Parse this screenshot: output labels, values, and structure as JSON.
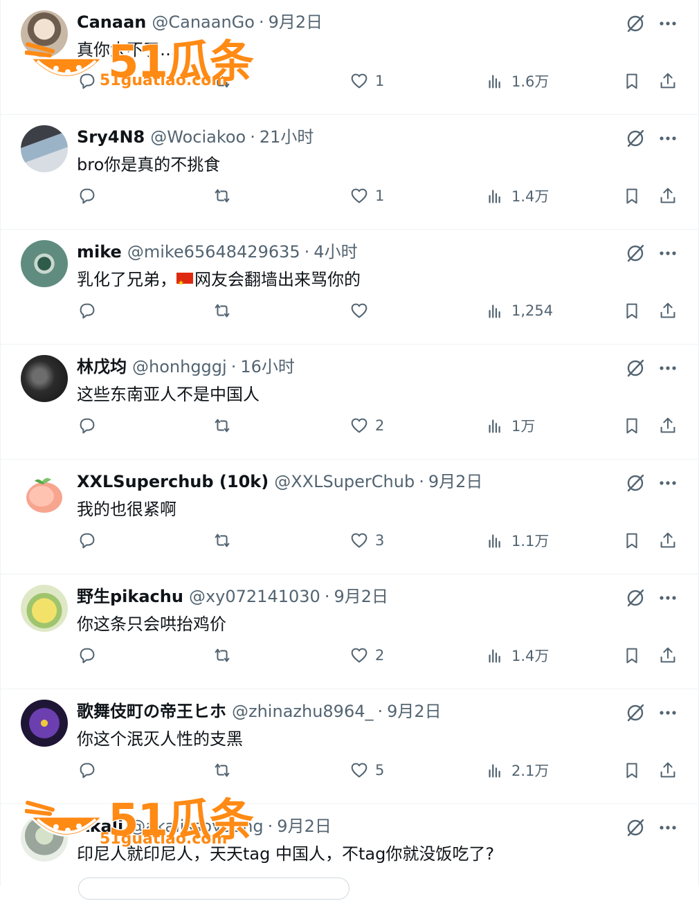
{
  "replies": [
    {
      "name": "Canaan",
      "handle": "@CanaanGo",
      "time": "9月2日",
      "text": "真你大不了…",
      "avatar_color": "#c8b8a6",
      "counts": {
        "reply": "",
        "retweet": "",
        "like": "1",
        "views": "1.6万"
      }
    },
    {
      "name": "Sry4N8",
      "handle": "@Wociakoo",
      "time": "21小时",
      "text": "bro你是真的不挑食",
      "avatar_color": "#5b6a7c",
      "counts": {
        "reply": "",
        "retweet": "",
        "like": "1",
        "views": "1.4万"
      }
    },
    {
      "name": "mike",
      "handle": "@mike65648429635",
      "time": "4小时",
      "text_before_flag": "乳化了兄弟，",
      "text": "网友会翻墙出来骂你的",
      "avatar_color": "#5f8c7e",
      "counts": {
        "reply": "",
        "retweet": "",
        "like": "",
        "views": "1,254"
      }
    },
    {
      "name": "林戊均",
      "handle": "@honhgggj",
      "time": "16小时",
      "text": "这些东南亚人不是中国人",
      "avatar_color": "#2c2c2c",
      "counts": {
        "reply": "",
        "retweet": "",
        "like": "2",
        "views": "1万"
      }
    },
    {
      "name": "XXLSuperchub (10k)",
      "handle": "@XXLSuperChub",
      "time": "9月2日",
      "text": "我的也很紧啊",
      "avatar_color": "#ffd9c9",
      "counts": {
        "reply": "",
        "retweet": "",
        "like": "3",
        "views": "1.1万"
      }
    },
    {
      "name": "野生pikachu",
      "handle": "@xy072141030",
      "time": "9月2日",
      "text": "你这条只会哄抬鸡价",
      "avatar_color": "#e8d55a",
      "counts": {
        "reply": "",
        "retweet": "",
        "like": "2",
        "views": "1.4万"
      }
    },
    {
      "name": "歌舞伎町の帝王ヒホ",
      "handle": "@zhinazhu8964_",
      "time": "9月2日",
      "text": "你这个泯灭人性的支黑",
      "avatar_color": "#3a2464",
      "counts": {
        "reply": "",
        "retweet": "",
        "like": "5",
        "views": "2.1万"
      }
    },
    {
      "name": "Akali",
      "handle": "@akaiissoyoung",
      "time": "9月2日",
      "text": "印尼人就印尼人，天天tag 中国人，不tag你就没饭吃了?",
      "avatar_color": "#9aa69c",
      "counts": {
        "reply": "",
        "retweet": "",
        "like": "",
        "views": ""
      }
    }
  ],
  "separator": "·",
  "watermark": {
    "brand": "51瓜条",
    "url": "51guatiao.com",
    "color": "#ff8a14"
  },
  "icons": {
    "grok": "grok-icon",
    "more": "more-icon",
    "reply": "reply-icon",
    "retweet": "retweet-icon",
    "like": "like-icon",
    "views": "views-icon",
    "bookmark": "bookmark-icon",
    "share": "share-icon"
  }
}
